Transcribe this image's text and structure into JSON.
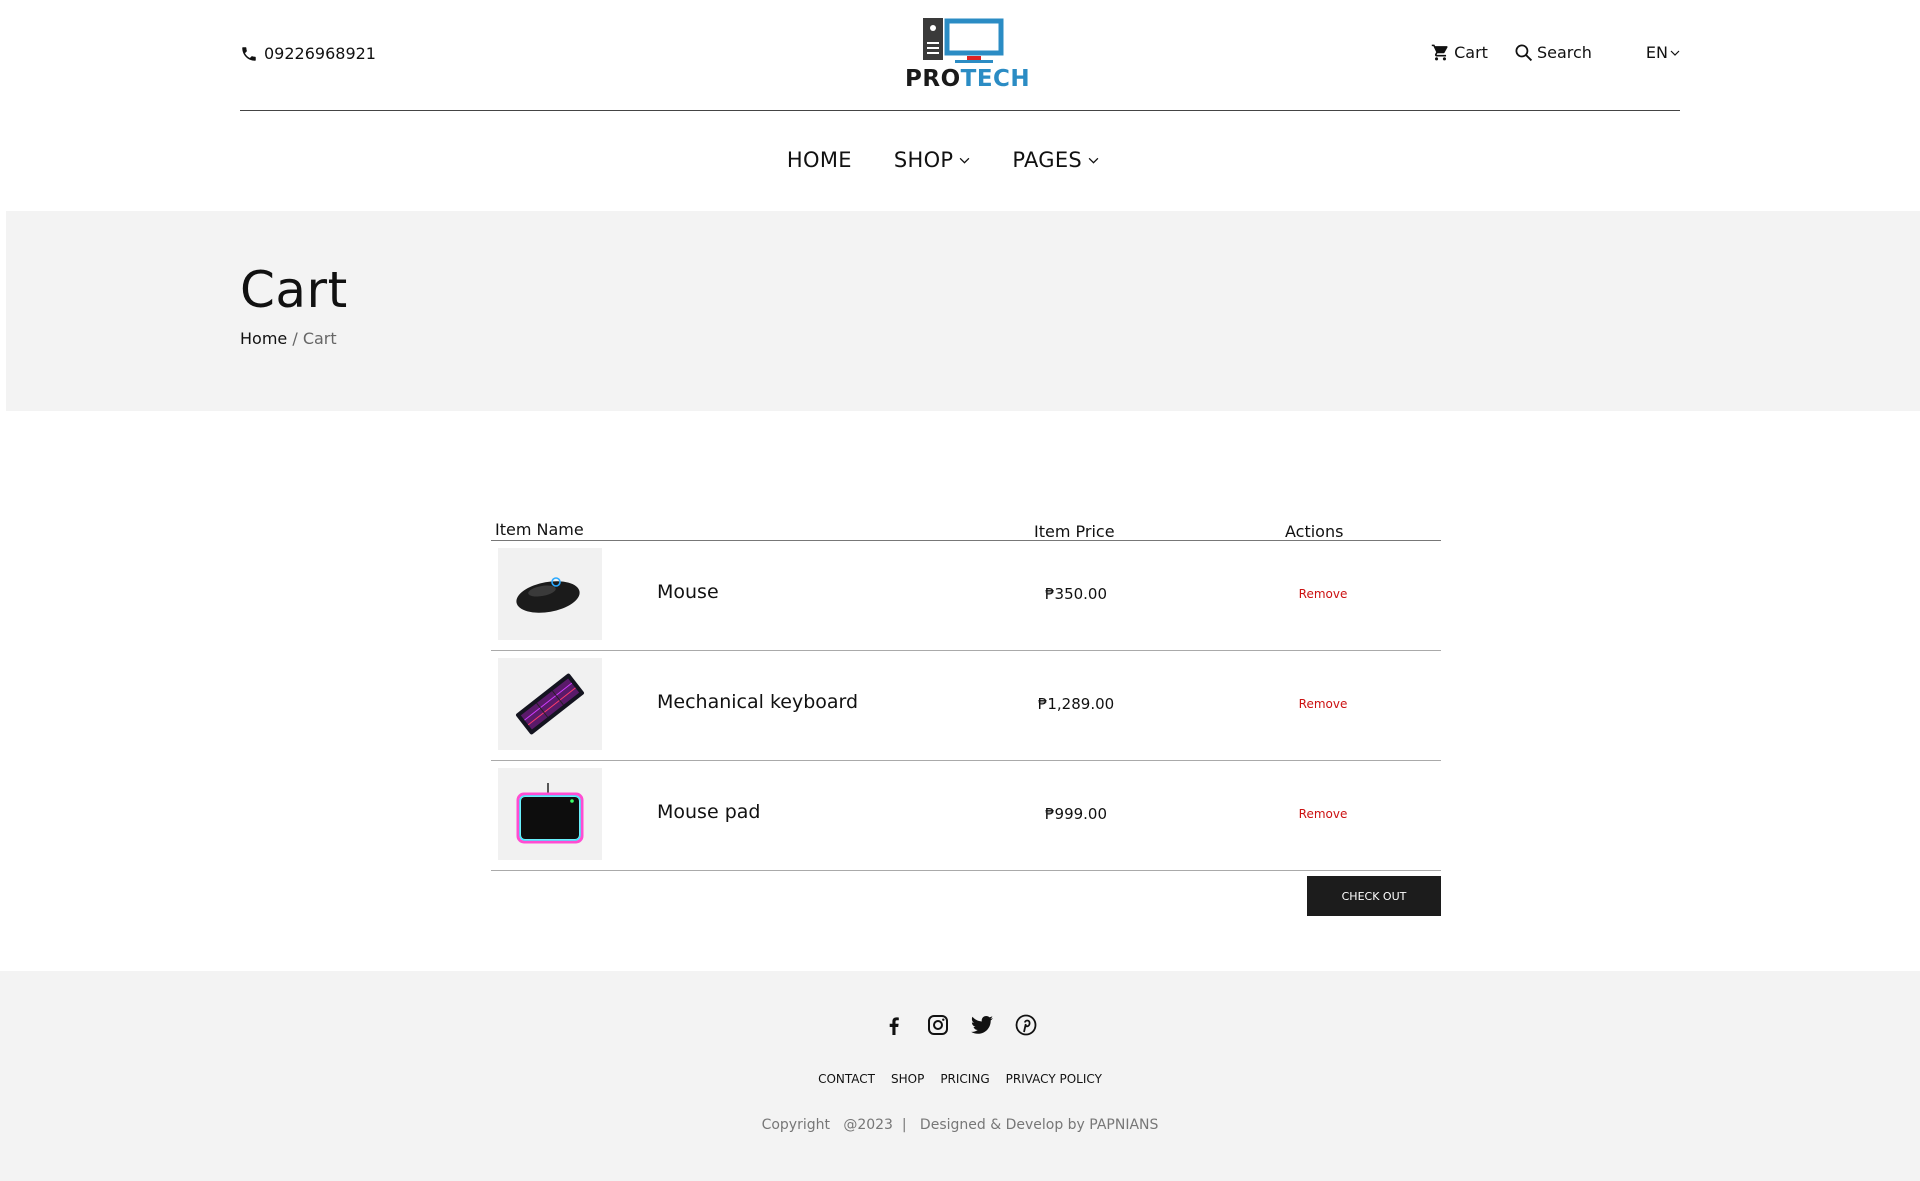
{
  "header": {
    "phone": "09226968921",
    "logo": {
      "pro": "PRO",
      "tech": "TECH"
    },
    "cart_label": "Cart",
    "search_label": "Search",
    "language": "EN",
    "colors": {
      "logo_blue": "#2b8cc4",
      "logo_dark": "#1a1a1a"
    }
  },
  "nav": {
    "home": "HOME",
    "shop": "SHOP",
    "pages": "PAGES"
  },
  "banner": {
    "title": "Cart",
    "breadcrumb_home": "Home",
    "breadcrumb_sep": "/",
    "breadcrumb_current": "Cart"
  },
  "cart": {
    "columns": {
      "name": "Item Name",
      "price": "Item Price",
      "actions": "Actions"
    },
    "items": [
      {
        "name": "Mouse",
        "price": "₱350.00",
        "action": "Remove",
        "image": "mouse-image"
      },
      {
        "name": "Mechanical keyboard",
        "price": "₱1,289.00",
        "action": "Remove",
        "image": "keyboard-image"
      },
      {
        "name": "Mouse pad",
        "price": "₱999.00",
        "action": "Remove",
        "image": "mousepad-image"
      }
    ],
    "checkout_label": "CHECK OUT",
    "colors": {
      "remove": "#cc1111",
      "checkout_bg": "#1c1c1c"
    }
  },
  "footer": {
    "social": [
      "facebook-icon",
      "instagram-icon",
      "twitter-icon",
      "pinterest-icon"
    ],
    "links": {
      "contact": "CONTACT",
      "shop": "SHOP",
      "pricing": "PRICING",
      "privacy": "PRIVACY POLICY"
    },
    "copyright": "Copyright   @2023  |   Designed & Develop by PAPNIANS"
  }
}
